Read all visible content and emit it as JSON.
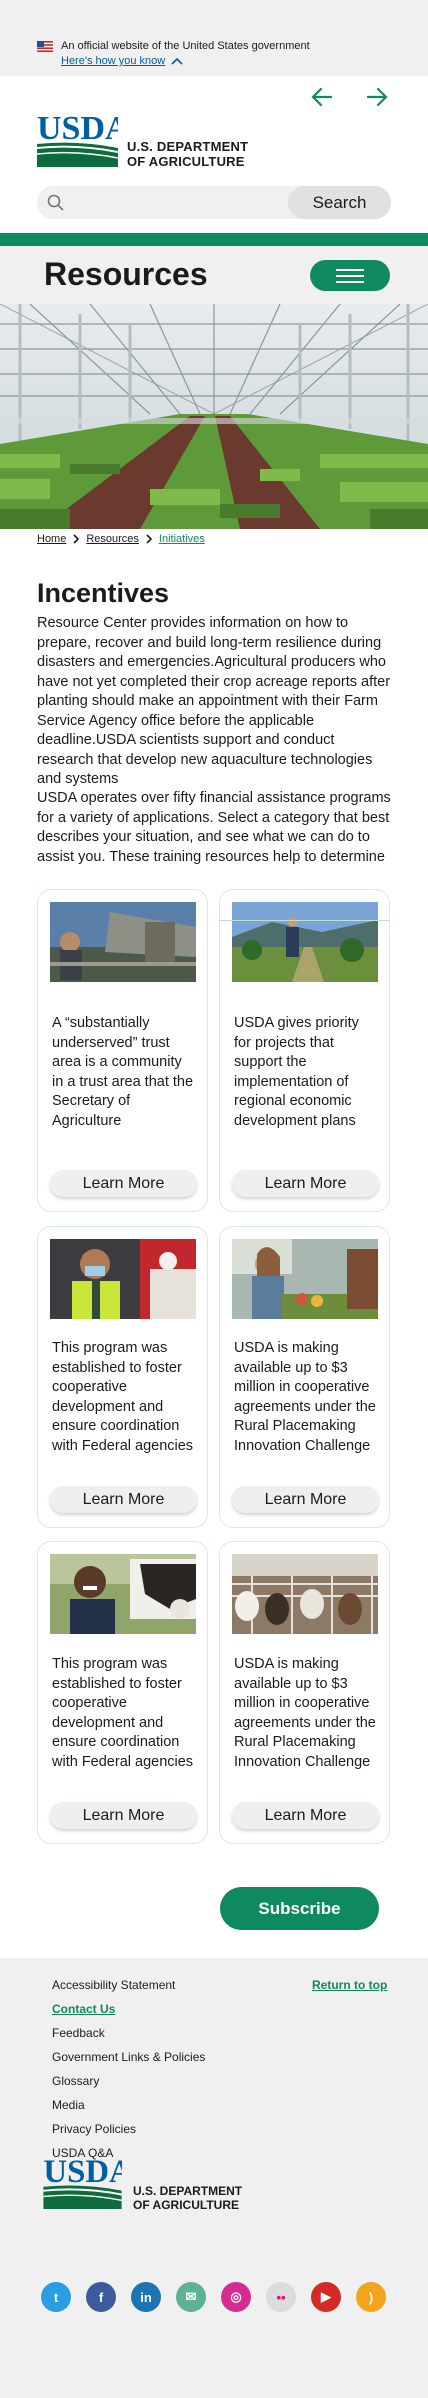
{
  "gov_banner": {
    "text": "An official website of the United States government",
    "link": "Here's how you know"
  },
  "header": {
    "logo_text": "USDA",
    "department_line1": "U.S. DEPARTMENT",
    "department_line2": "OF AGRICULTURE"
  },
  "search": {
    "placeholder": "",
    "button_label": "Search"
  },
  "section_title": "Resources",
  "breadcrumb": [
    "Home",
    "Resources",
    "Initiatives"
  ],
  "page": {
    "title": "Incentives",
    "intro_1": "Resource Center provides information on how to prepare, recover and build long-term resilience during disasters and emergencies.Agricultural producers who have not yet completed their crop acreage reports after planting should make an appointment with their Farm Service Agency office before the applicable deadline.USDA scientists support and conduct research that develop new aquaculture technologies and systems",
    "intro_2": "USDA operates over fifty financial assistance programs for a variety of applications. Select a category that best describes your situation, and see what we can do to assist you. These training resources help to determine"
  },
  "cards": [
    {
      "text": "A “substantially underserved” trust area is a community in a trust area that the Secretary of Agriculture",
      "button": "Learn More"
    },
    {
      "text": "USDA gives priority for projects that support the implementation of regional economic development plans",
      "button": "Learn More"
    },
    {
      "text": "This program was established to foster cooperative development and ensure coordination with Federal agencies",
      "button": "Learn More"
    },
    {
      "text": "USDA is making available up to $3 million in cooperative agreements under the Rural Placemaking Innovation Challenge",
      "button": "Learn More"
    },
    {
      "text": "This program was established to foster cooperative development and ensure coordination with Federal agencies",
      "button": "Learn More"
    },
    {
      "text": "USDA is making available up to $3 million in cooperative agreements under the Rural Placemaking Innovation Challenge",
      "button": "Learn More"
    }
  ],
  "subscribe_label": "Subscribe",
  "footer": {
    "links": [
      "Accessibility Statement",
      "Contact Us",
      "Feedback",
      "Government Links & Policies",
      "Glossary",
      "Media",
      "Privacy Policies",
      "USDA Q&A"
    ],
    "active_link": "Contact Us",
    "return_to_top": "Return to top",
    "social": [
      {
        "icon": "twitter-icon",
        "color": "#2a9ee0",
        "glyph": "t"
      },
      {
        "icon": "facebook-icon",
        "color": "#3b5b9c",
        "glyph": "f"
      },
      {
        "icon": "linkedin-icon",
        "color": "#1b75b5",
        "glyph": "in"
      },
      {
        "icon": "email-icon",
        "color": "#5fb193",
        "glyph": "✉"
      },
      {
        "icon": "instagram-icon",
        "color": "#d52b93",
        "glyph": "◎"
      },
      {
        "icon": "flickr-icon",
        "color": "#dcdcdc",
        "glyph": "••"
      },
      {
        "icon": "youtube-icon",
        "color": "#d22b27",
        "glyph": "▶"
      },
      {
        "icon": "rss-icon",
        "color": "#f2a41c",
        "glyph": ")"
      }
    ]
  },
  "colors": {
    "brand_green": "#0f8a5f",
    "usda_blue": "#005ea2",
    "background_gray": "#f0f0f0"
  }
}
